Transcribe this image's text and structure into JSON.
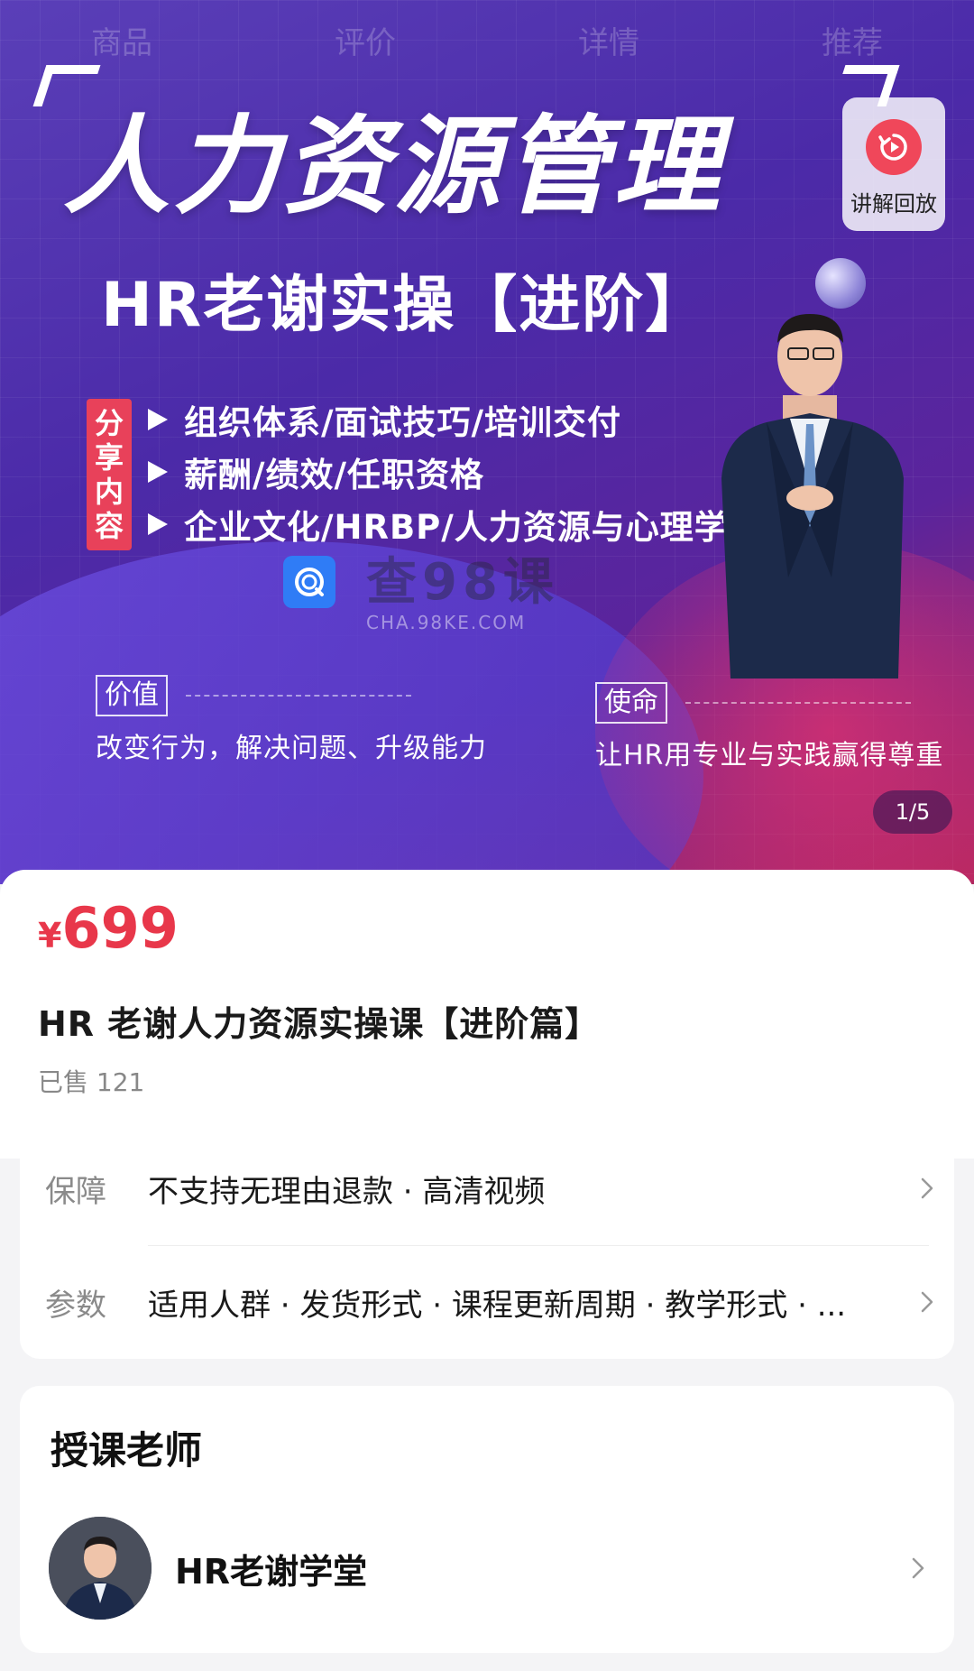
{
  "top_tabs": [
    "商品",
    "评价",
    "详情",
    "推荐"
  ],
  "banner": {
    "main_title": "人力资源管理",
    "sub_title": "HR老谢实操【进阶】",
    "replay_label": "讲解回放",
    "share_tag": [
      "分",
      "享",
      "内",
      "容"
    ],
    "bullets": [
      "组织体系/面试技巧/培训交付",
      "薪酬/绩效/任职资格",
      "企业文化/HRBP/人力资源与心理学"
    ],
    "watermark_cn": "查98课",
    "watermark_en": "CHA.98KE.COM",
    "value_label": "价值",
    "value_text": "改变行为，解决问题、升级能力",
    "mission_label": "使命",
    "mission_text": "让HR用专业与实践赢得尊重",
    "page_indicator": "1/5"
  },
  "product": {
    "currency": "¥",
    "price": "699",
    "title": "HR 老谢人力资源实操课【进阶篇】",
    "sold": "已售 121"
  },
  "details": [
    {
      "key": "保障",
      "value": "不支持无理由退款 · 高清视频"
    },
    {
      "key": "参数",
      "value": "适用人群 · 发货形式 · 课程更新周期 · 教学形式 · ..."
    }
  ],
  "teacher": {
    "heading": "授课老师",
    "name": "HR老谢学堂"
  },
  "colors": {
    "price_red": "#e8374a",
    "replay_red": "#f0475a",
    "banner_purple": "#4b2aa8"
  }
}
